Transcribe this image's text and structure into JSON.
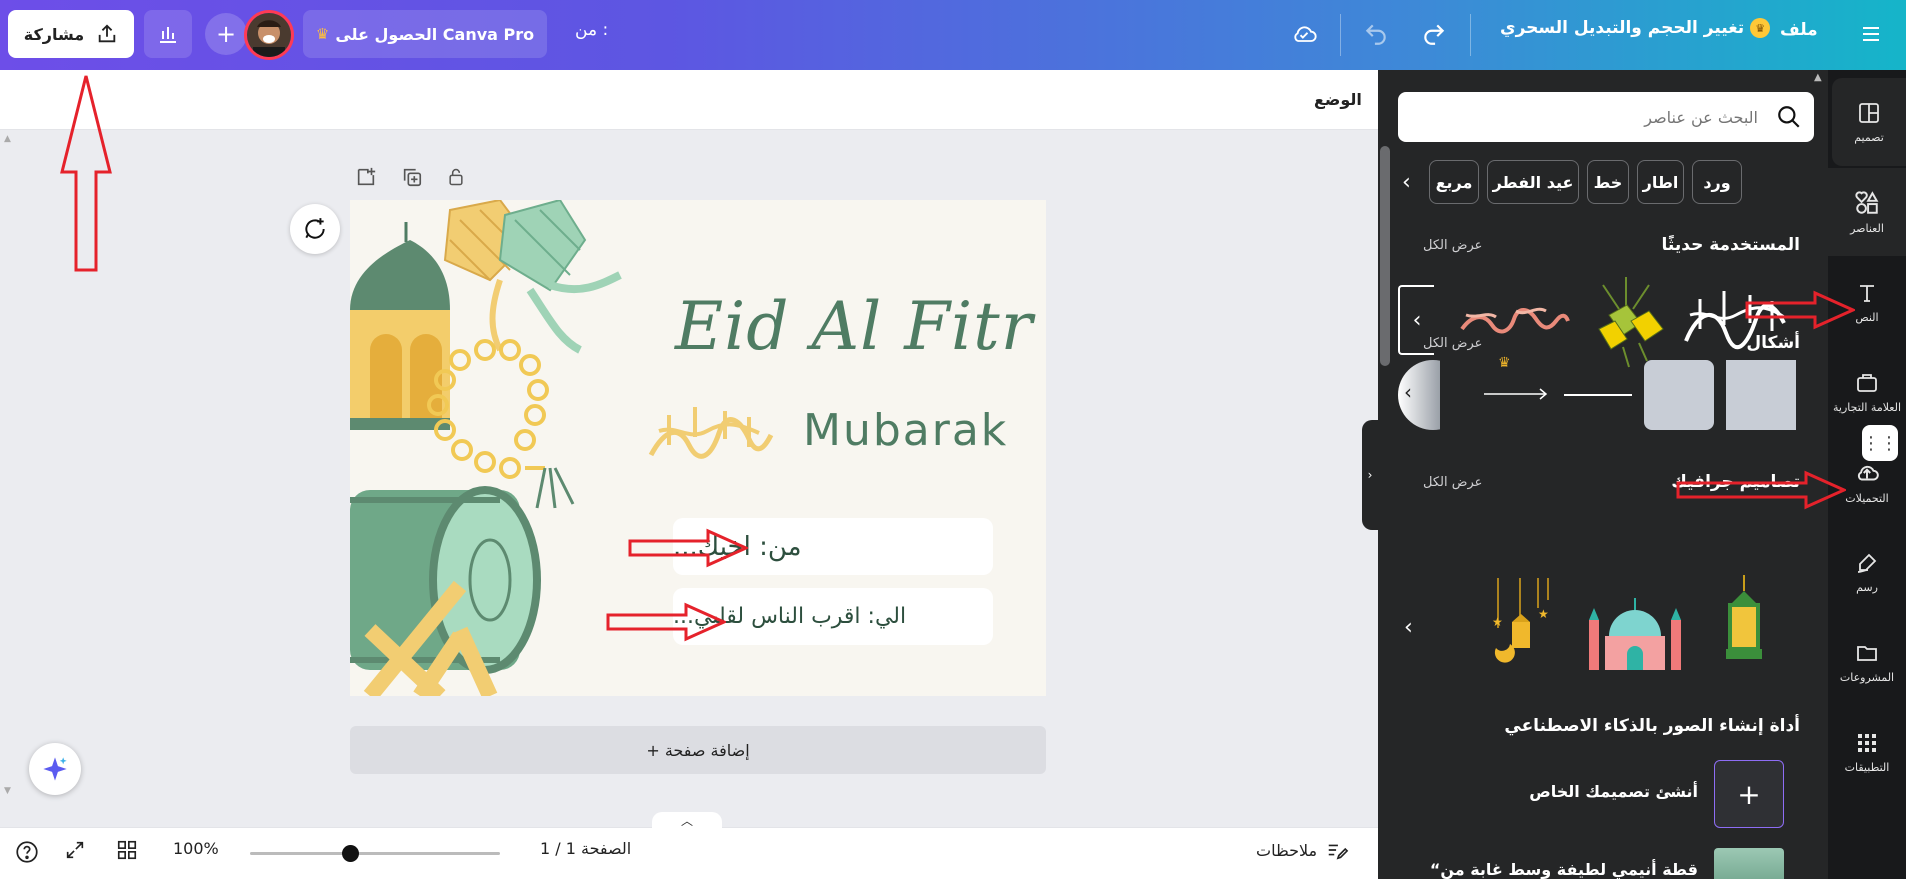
{
  "topbar": {
    "share_label": "مشاركة",
    "pro_label": "الحصول على Canva Pro",
    "from_label": "من :",
    "resize_label": "تغيير الحجم والتبديل السحري",
    "file_label": "ملف"
  },
  "rail": {
    "items": [
      {
        "label": "تصميم",
        "icon": "layout-icon"
      },
      {
        "label": "العناصر",
        "icon": "elements-icon"
      },
      {
        "label": "النص",
        "icon": "text-icon"
      },
      {
        "label": "العلامة التجارية",
        "icon": "brand-icon"
      },
      {
        "label": "التحميلات",
        "icon": "upload-icon"
      },
      {
        "label": "رسم",
        "icon": "draw-icon"
      },
      {
        "label": "المشروعات",
        "icon": "folder-icon"
      },
      {
        "label": "التطبيقات",
        "icon": "apps-icon"
      }
    ]
  },
  "panel": {
    "search_placeholder": "البحث عن عناصر",
    "chips": [
      "ورد",
      "اطار",
      "خط",
      "عيد الفطر",
      "مربع"
    ],
    "recent_title": "المستخدمة حديثًا",
    "shapes_title": "أشكال",
    "graphics_title": "تصاميم جرافيك",
    "see_all": "عرض الكل",
    "ai_title": "أداة إنشاء الصور بالذكاء الاصطناعي",
    "create_label": "أنشئ تصميمك الخاص",
    "last_label": "“قطة أنيمي لطيفة وسط غابة من"
  },
  "canvas": {
    "position_label": "الوضع",
    "design_title": "Eid Al Fitr",
    "design_subtitle": "Mubarak",
    "from_text": "من: اخيك...",
    "to_text": "الي: اقرب الناس لقلبي...",
    "add_page_label": "+ إضافة صفحة"
  },
  "bottombar": {
    "notes_label": "ملاحظات",
    "page_label": "الصفحة 1 / 1",
    "zoom_label": "100%",
    "zoom_level": 0.4
  },
  "colors": {
    "accent": "#6d4ee8",
    "panel_bg": "#252627",
    "rail_bg": "#18191b",
    "design_green": "#4f7c63",
    "arrow_red": "#e5222b"
  }
}
